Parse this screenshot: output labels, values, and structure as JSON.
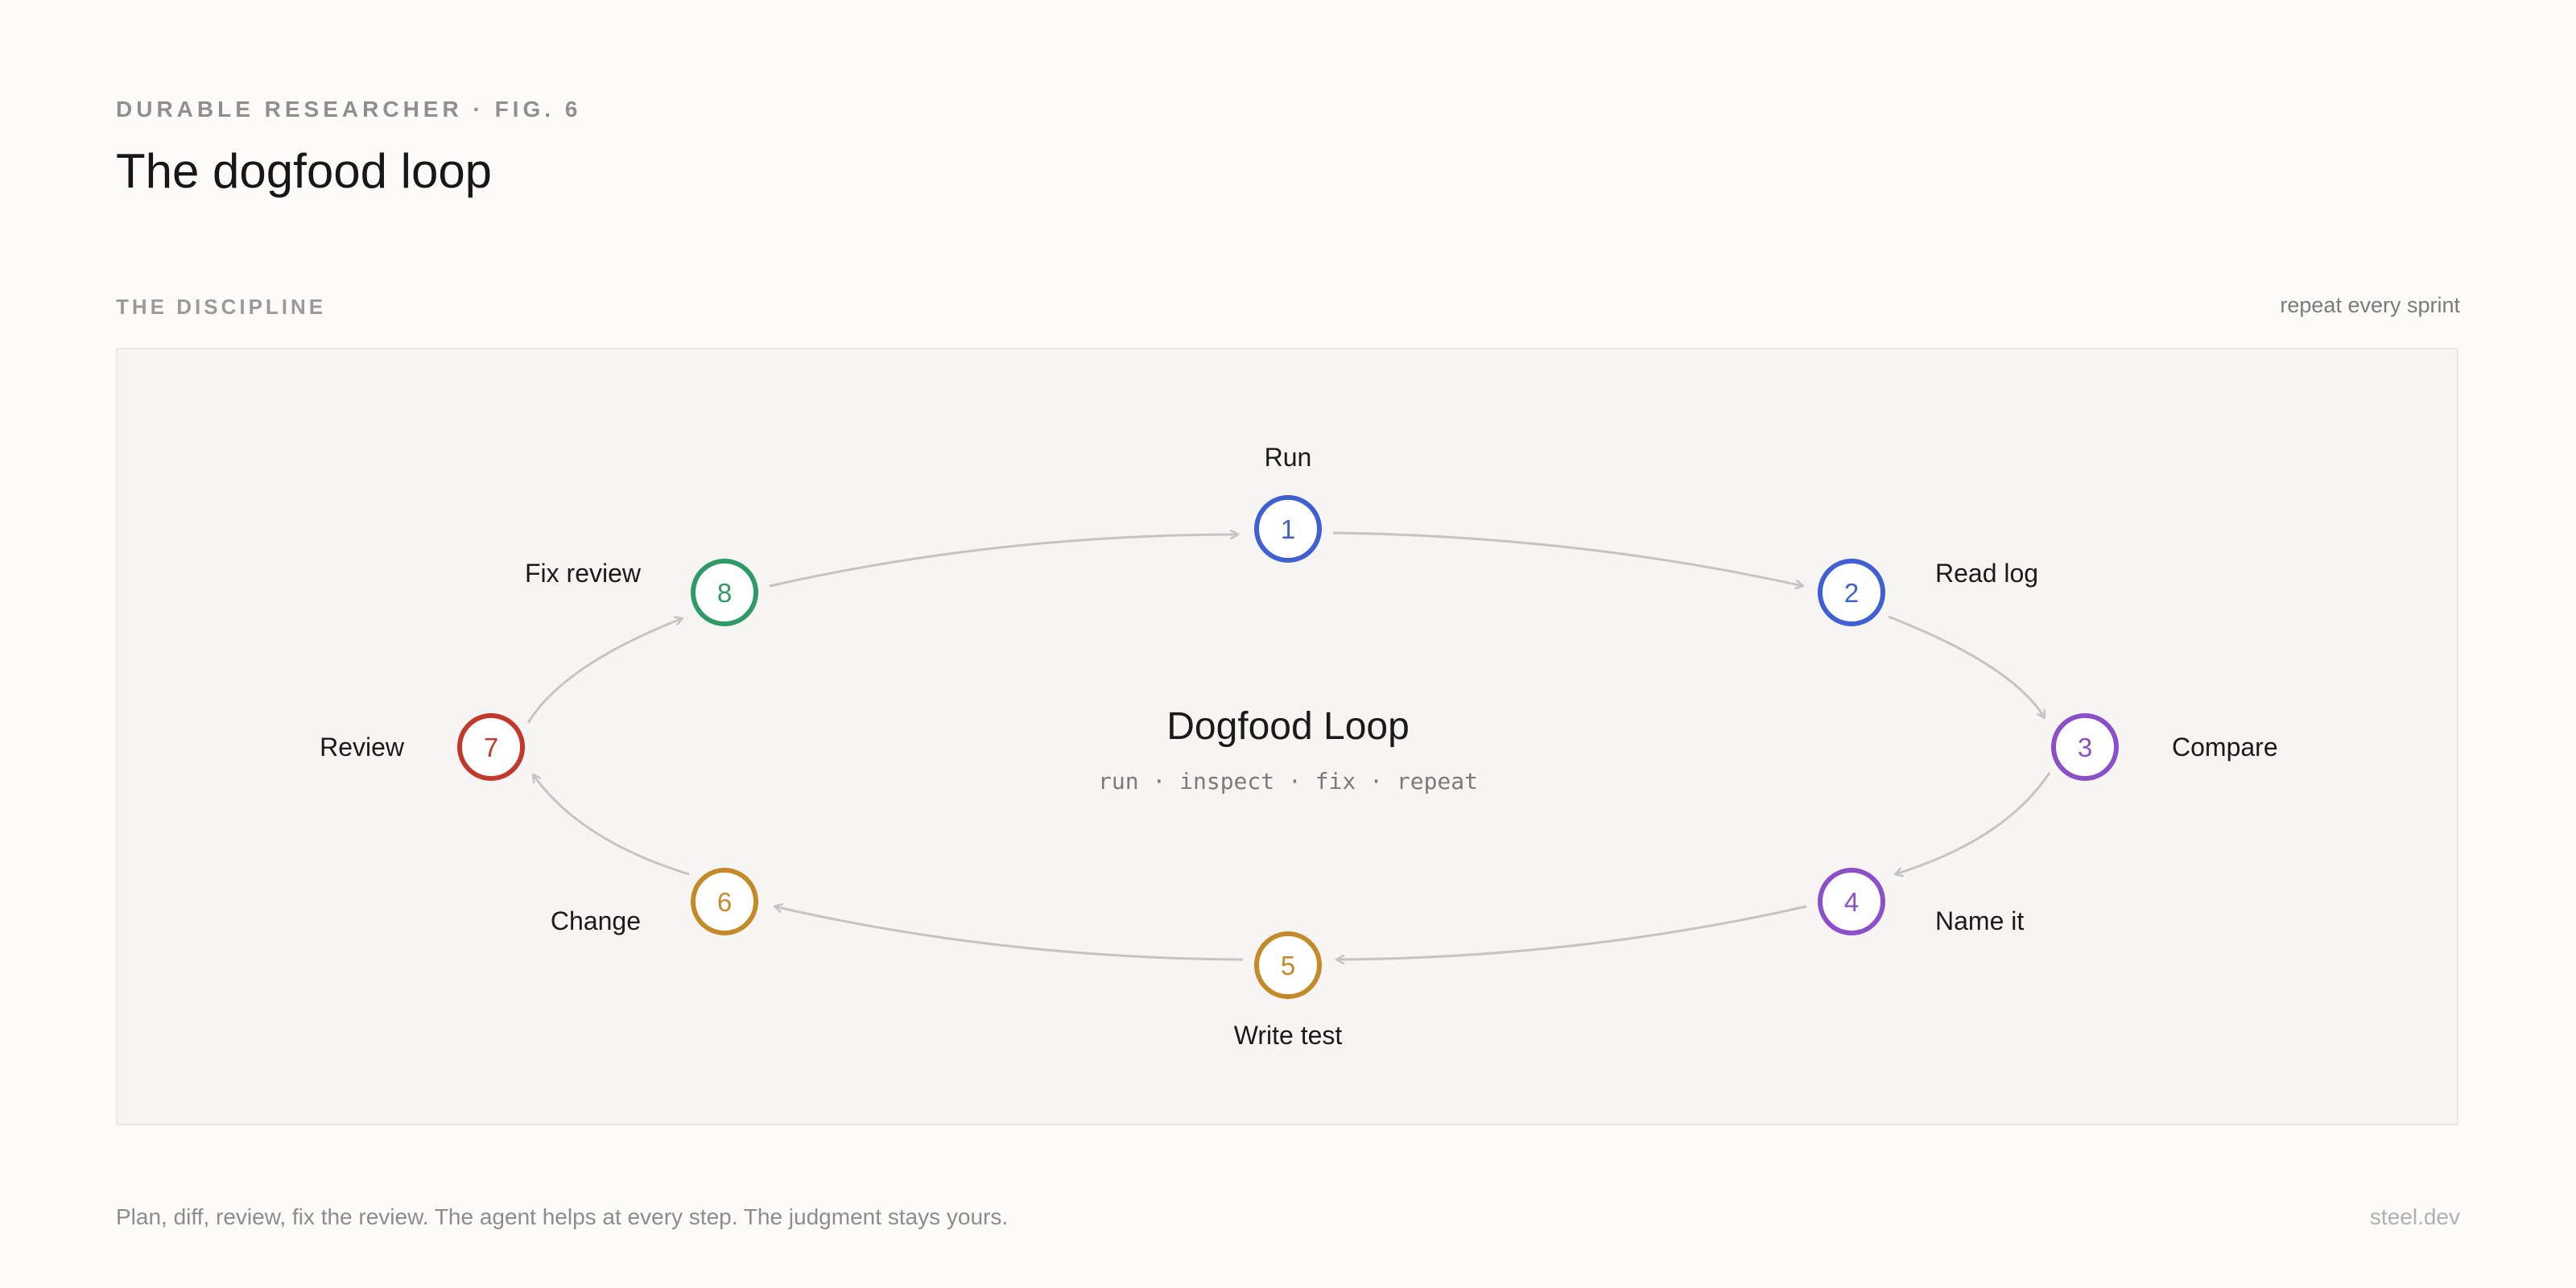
{
  "header": {
    "eyebrow": "DURABLE RESEARCHER · FIG. 6",
    "title": "The dogfood loop"
  },
  "section": {
    "label": "THE DISCIPLINE",
    "note": "repeat every sprint"
  },
  "center": {
    "title": "Dogfood Loop",
    "subtitle": "run · inspect · fix · repeat"
  },
  "colors": {
    "blue": "#3f5fd3",
    "purple": "#8a4fc9",
    "gold": "#c48a2a",
    "red": "#c0392b",
    "green": "#2e9a66",
    "arrow": "#c4c4c4"
  },
  "steps": [
    {
      "number": "1",
      "label": "Run",
      "color": "#3f5fd3"
    },
    {
      "number": "2",
      "label": "Read log",
      "color": "#3f5fd3"
    },
    {
      "number": "3",
      "label": "Compare",
      "color": "#8a4fc9"
    },
    {
      "number": "4",
      "label": "Name it",
      "color": "#8a4fc9"
    },
    {
      "number": "5",
      "label": "Write test",
      "color": "#c48a2a"
    },
    {
      "number": "6",
      "label": "Change",
      "color": "#c48a2a"
    },
    {
      "number": "7",
      "label": "Review",
      "color": "#c0392b"
    },
    {
      "number": "8",
      "label": "Fix review",
      "color": "#2e9a66"
    }
  ],
  "footer": {
    "text": "Plan, diff, review, fix the review. The agent helps at every step. The judgment stays yours.",
    "brand": "steel.dev"
  }
}
